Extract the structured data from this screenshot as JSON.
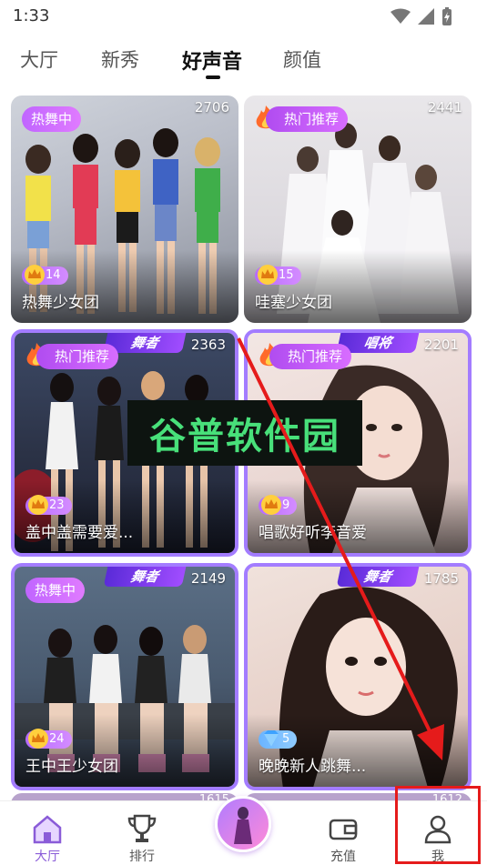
{
  "status": {
    "time": "1:33",
    "icons": [
      "wifi-icon",
      "signal-icon",
      "battery-charging-icon"
    ]
  },
  "tabs": [
    {
      "label": "大厅",
      "active": false
    },
    {
      "label": "新秀",
      "active": false
    },
    {
      "label": "好声音",
      "active": true
    },
    {
      "label": "颜值",
      "active": false
    }
  ],
  "cards": [
    {
      "badge": "热舞中",
      "badge_type": "dance",
      "viewers": "2706",
      "level": "14",
      "level_icon": "crown-icon",
      "title": "热舞少女团",
      "role_tag": ""
    },
    {
      "badge": "热门推荐",
      "badge_type": "hot",
      "viewers": "2441",
      "level": "15",
      "level_icon": "crown-icon",
      "title": "哇塞少女团",
      "role_tag": ""
    },
    {
      "badge": "热门推荐",
      "badge_type": "hot",
      "viewers": "2363",
      "level": "23",
      "level_icon": "crown-icon",
      "title": "盖中盖需要爱...",
      "role_tag": "舞者"
    },
    {
      "badge": "热门推荐",
      "badge_type": "hot",
      "viewers": "2201",
      "level": "9",
      "level_icon": "crown-icon",
      "title": "唱歌好听李音爱",
      "role_tag": "唱将"
    },
    {
      "badge": "热舞中",
      "badge_type": "dance",
      "viewers": "2149",
      "level": "24",
      "level_icon": "crown-icon",
      "title": "王中王少女团",
      "role_tag": "舞者"
    },
    {
      "badge": "",
      "badge_type": "",
      "viewers": "1785",
      "level": "5",
      "level_icon": "diamond-icon",
      "title": "晚晚新人跳舞...",
      "role_tag": "舞者"
    }
  ],
  "partial_viewers": [
    "1615",
    "1612"
  ],
  "watermark": "谷普软件园",
  "nav": [
    {
      "label": "大厅",
      "icon": "home-icon",
      "active": true
    },
    {
      "label": "排行",
      "icon": "trophy-icon",
      "active": false
    },
    {
      "label": "",
      "icon": "live-center-icon",
      "active": false
    },
    {
      "label": "充值",
      "icon": "wallet-icon",
      "active": false
    },
    {
      "label": "我",
      "icon": "user-icon",
      "active": false
    }
  ],
  "colors": {
    "accent": "#8a5cd8",
    "frame": "#a37cff",
    "highlight": "#e51b1b",
    "watermark": "#48e07a"
  }
}
